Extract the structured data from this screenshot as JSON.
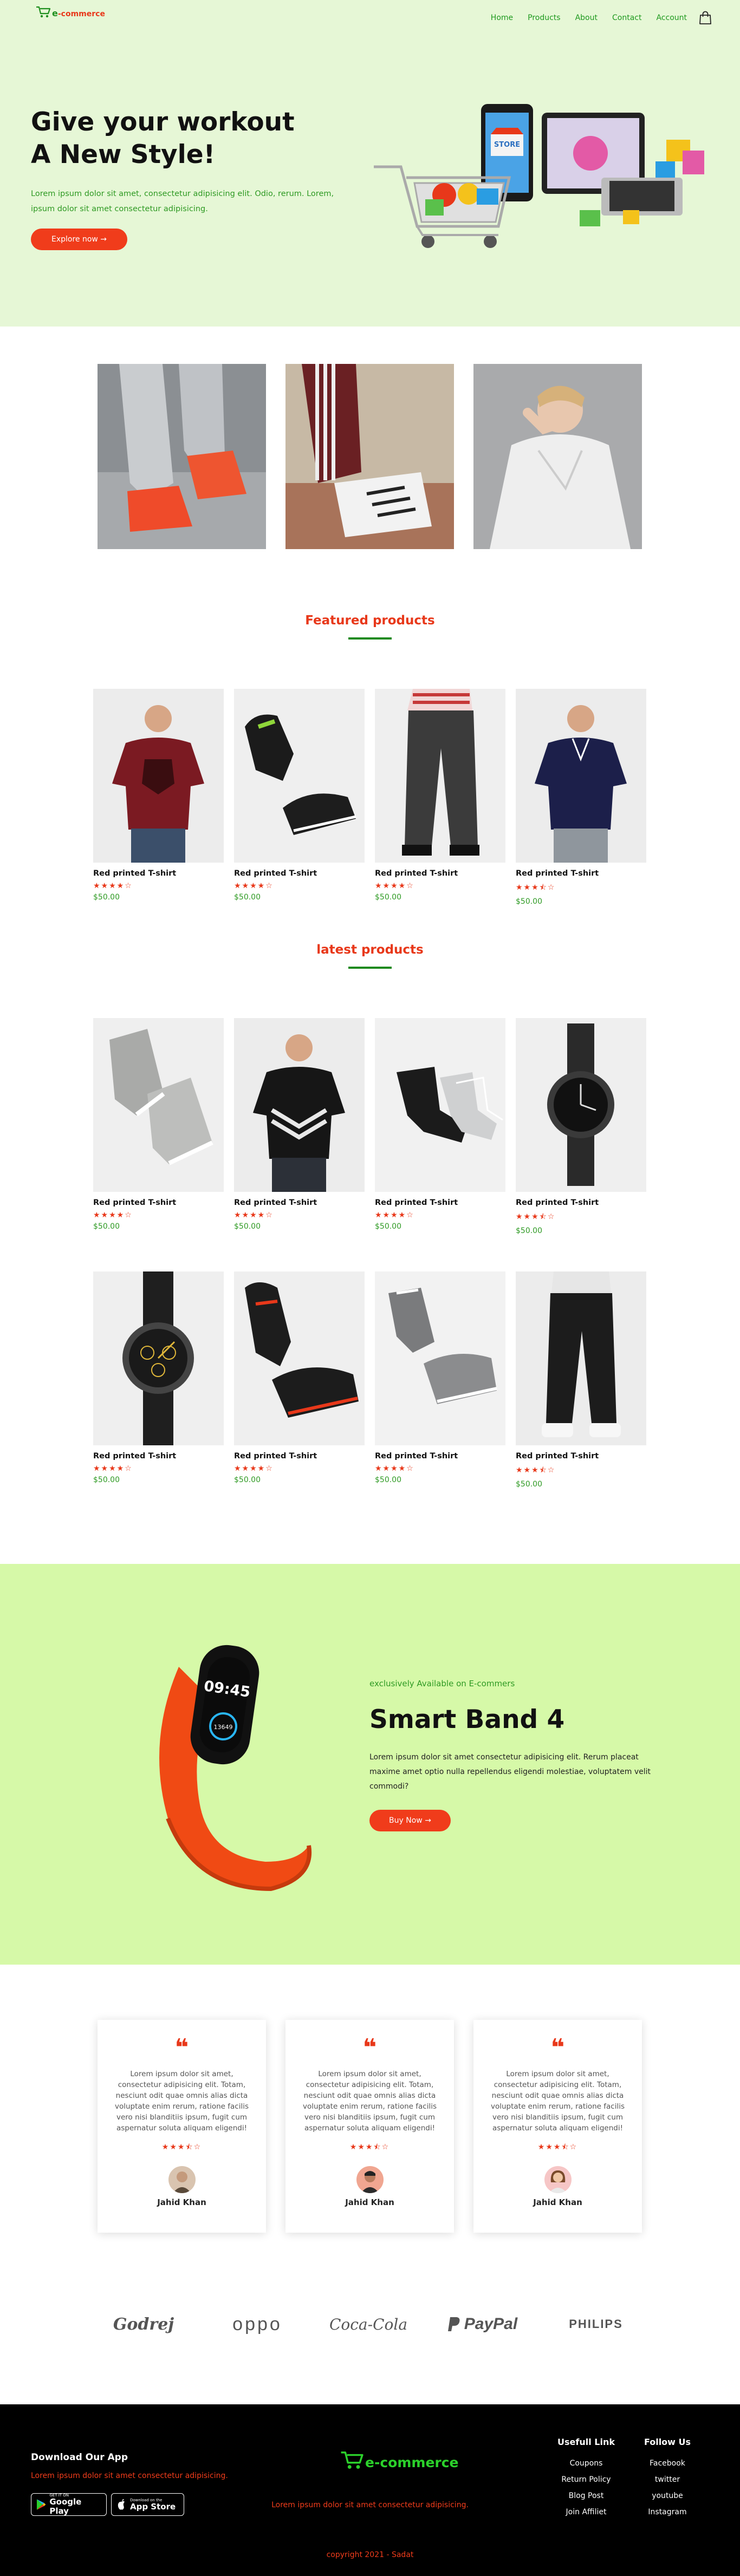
{
  "brand": {
    "logo_e": "e",
    "logo_rest": "-commerce"
  },
  "nav": {
    "items": [
      "Home",
      "Products",
      "About",
      "Contact",
      "Account"
    ]
  },
  "hero": {
    "title_line1": "Give your workout",
    "title_line2": "A New Style!",
    "lead": "Lorem ipsum dolor sit amet, consectetur adipisicing elit. Odio, rerum. Lorem, ipsum dolor sit amet consectetur adipisicing.",
    "cta": "Explore now →",
    "store_sign": "STORE"
  },
  "featured": {
    "title": "Featured products",
    "items": [
      {
        "name": "Red printed T-shirt",
        "stars": "★★★★☆",
        "price": "$50.00"
      },
      {
        "name": "Red printed T-shirt",
        "stars": "★★★★☆",
        "price": "$50.00"
      },
      {
        "name": "Red printed T-shirt",
        "stars": "★★★★☆",
        "price": "$50.00"
      },
      {
        "name": "Red printed T-shirt",
        "stars": "★★★⯪☆",
        "price": "$50.00"
      }
    ]
  },
  "latest": {
    "title": "latest products",
    "items": [
      {
        "name": "Red printed T-shirt",
        "stars": "★★★★☆",
        "price": "$50.00"
      },
      {
        "name": "Red printed T-shirt",
        "stars": "★★★★☆",
        "price": "$50.00"
      },
      {
        "name": "Red printed T-shirt",
        "stars": "★★★★☆",
        "price": "$50.00"
      },
      {
        "name": "Red printed T-shirt",
        "stars": "★★★⯪☆",
        "price": "$50.00"
      },
      {
        "name": "Red printed T-shirt",
        "stars": "★★★★☆",
        "price": "$50.00"
      },
      {
        "name": "Red printed T-shirt",
        "stars": "★★★★☆",
        "price": "$50.00"
      },
      {
        "name": "Red printed T-shirt",
        "stars": "★★★★☆",
        "price": "$50.00"
      },
      {
        "name": "Red printed T-shirt",
        "stars": "★★★⯪☆",
        "price": "$50.00"
      }
    ]
  },
  "promo": {
    "exclusive": "exclusively Available on E-commers",
    "title": "Smart Band 4",
    "desc": "Lorem ipsum dolor sit amet consectetur adipisicing elit. Rerum placeat maxime amet optio nulla repellendus eligendi molestiae, voluptatem velit commodi?",
    "cta": "Buy Now →",
    "band_time": "09:45",
    "band_steps": "13649"
  },
  "testimonials": [
    {
      "quote": "❝",
      "text": "Lorem ipsum dolor sit amet, consectetur adipisicing elit. Totam, nesciunt odit quae omnis alias dicta voluptate enim rerum, ratione facilis vero nisi blanditiis ipsum, fugit cum aspernatur soluta aliquam eligendi!",
      "stars": "★★★⯪☆",
      "name": "Jahid Khan"
    },
    {
      "quote": "❝",
      "text": "Lorem ipsum dolor sit amet, consectetur adipisicing elit. Totam, nesciunt odit quae omnis alias dicta voluptate enim rerum, ratione facilis vero nisi blanditiis ipsum, fugit cum aspernatur soluta aliquam eligendi!",
      "stars": "★★★⯪☆",
      "name": "Jahid Khan"
    },
    {
      "quote": "❝",
      "text": "Lorem ipsum dolor sit amet, consectetur adipisicing elit. Totam, nesciunt odit quae omnis alias dicta voluptate enim rerum, ratione facilis vero nisi blanditiis ipsum, fugit cum aspernatur soluta aliquam eligendi!",
      "stars": "★★★⯪☆",
      "name": "Jahid Khan"
    }
  ],
  "brands": [
    "Godrej",
    "oppo",
    "Coca-Cola",
    "PayPal",
    "PHILIPS"
  ],
  "footer": {
    "download_title": "Download Our App",
    "download_sub": "Lorem ipsum dolor sit amet consectetur adipisicing.",
    "google_small": "GET IT ON",
    "google_big": "Google Play",
    "apple_small": "Download on the",
    "apple_big": "App Store",
    "logo_e": "e",
    "logo_rest": "-commerce",
    "mid_text": "Lorem ipsum dolor sit amet consectetur adipisicing.",
    "useful_title": "Usefull Link",
    "useful_links": [
      "Coupons",
      "Return Policy",
      "Blog Post",
      "Join Affiliet"
    ],
    "follow_title": "Follow Us",
    "follow_links": [
      "Facebook",
      "twitter",
      "youtube",
      "Instagram"
    ],
    "copyright": "copyright 2021 - Sadat"
  },
  "colors": {
    "accent": "#f03c1b",
    "green": "#2e9a23",
    "hero_bg": "#e6f7d6",
    "promo_bg": "#d6f9a8"
  }
}
